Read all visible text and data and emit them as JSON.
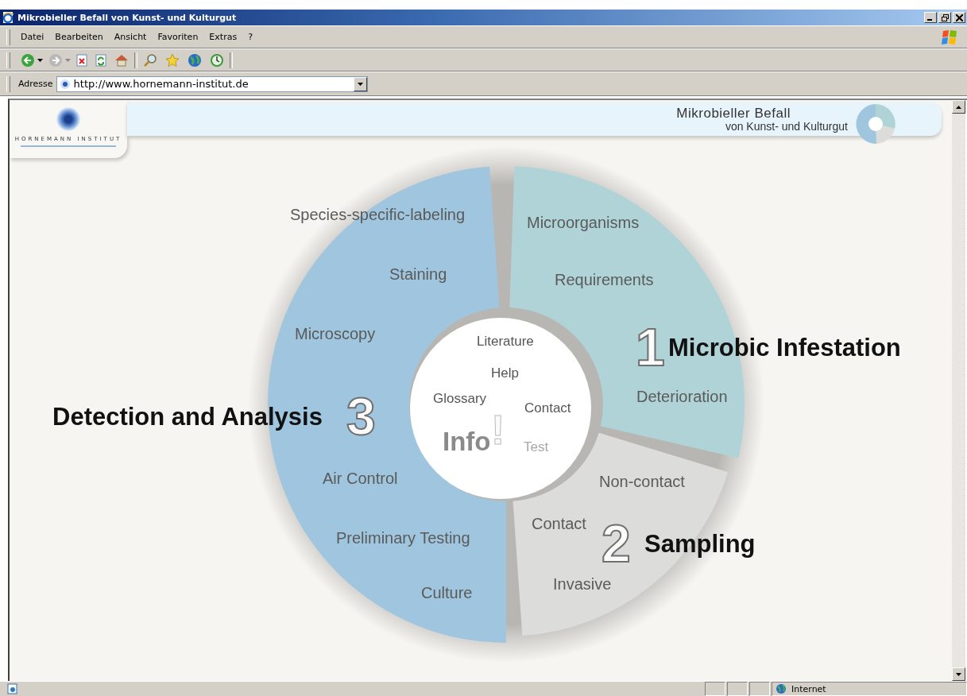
{
  "window": {
    "title": "Mikrobieller Befall von Kunst- und Kulturgut"
  },
  "menu": [
    "Datei",
    "Bearbeiten",
    "Ansicht",
    "Favoriten",
    "Extras",
    "?"
  ],
  "address": {
    "label": "Adresse",
    "value": "http://www.hornemann-institut.de"
  },
  "header": {
    "logo_text": "HORNEMANN INSTITUT",
    "title": "Mikrobieller Befall",
    "subtitle": "von Kunst- und Kulturgut"
  },
  "diagram": {
    "sections": [
      {
        "number": "1",
        "title": "Microbic Infestation",
        "color": "#afd3d6",
        "links": [
          "Microorganisms",
          "Requirements",
          "Deterioration"
        ]
      },
      {
        "number": "2",
        "title": "Sampling",
        "color": "#dcdcda",
        "links": [
          "Non-contact",
          "Contact",
          "Invasive"
        ]
      },
      {
        "number": "3",
        "title": "Detection and Analysis",
        "color": "#9fc6de",
        "links": [
          "Species-specific-labeling",
          "Staining",
          "Microscopy",
          "Air Control",
          "Preliminary Testing",
          "Culture"
        ]
      }
    ],
    "center": {
      "title": "Info",
      "mark": "!",
      "links": [
        {
          "label": "Literature",
          "disabled": false
        },
        {
          "label": "Help",
          "disabled": false
        },
        {
          "label": "Glossary",
          "disabled": false
        },
        {
          "label": "Contact",
          "disabled": false
        },
        {
          "label": "Test",
          "disabled": true
        }
      ]
    }
  },
  "status_bar": {
    "zone": "Internet"
  }
}
